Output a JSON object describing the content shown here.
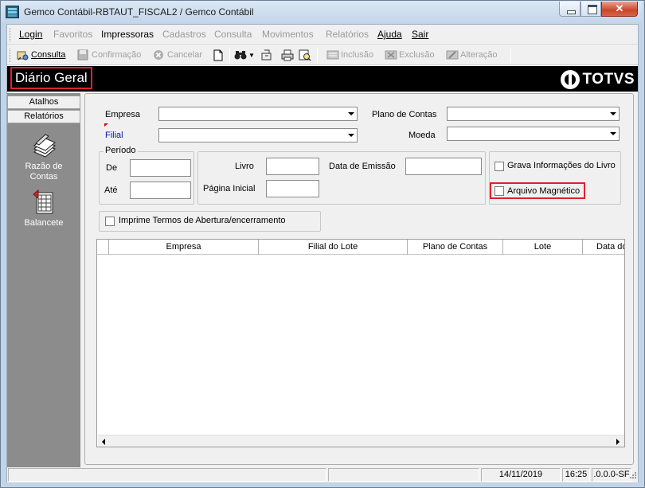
{
  "window": {
    "title": "Gemco Contábil-RBTAUT_FISCAL2 / Gemco Contábil"
  },
  "menu": {
    "items": [
      {
        "label": "Login",
        "enabled": true
      },
      {
        "label": "Favoritos",
        "enabled": false
      },
      {
        "label": "Impressoras",
        "enabled": true
      },
      {
        "label": "Cadastros",
        "enabled": false
      },
      {
        "label": "Consulta",
        "enabled": false
      },
      {
        "label": "Movimentos",
        "enabled": false
      },
      {
        "label": "Relatórios",
        "enabled": false
      },
      {
        "label": "Ajuda",
        "enabled": true
      },
      {
        "label": "Sair",
        "enabled": true
      }
    ]
  },
  "toolbar": {
    "consulta": "Consulta",
    "confirmacao": "Confirmação",
    "cancelar": "Cancelar",
    "inclusao": "Inclusão",
    "exclusao": "Exclusão",
    "alteracao": "Alteração"
  },
  "banner": {
    "title": "Diário Geral",
    "logo_text": "TOTVS"
  },
  "sidebar": {
    "tabs": [
      "Atalhos",
      "Relatórios"
    ],
    "apps": [
      {
        "line1": "Razão de",
        "line2": "Contas",
        "icon": "ledger-icon"
      },
      {
        "line1": "Balancete",
        "line2": "",
        "icon": "balance-sheet-icon"
      }
    ]
  },
  "form": {
    "empresa_label": "Empresa",
    "empresa_value": "",
    "filial_label": "Filial",
    "filial_value": "",
    "plano_label": "Plano de Contas",
    "plano_value": "",
    "moeda_label": "Moeda",
    "moeda_value": "",
    "periodo": {
      "legend": "Período",
      "de_label": "De",
      "de_value": "",
      "ate_label": "Até",
      "ate_value": ""
    },
    "livro_label": "Livro",
    "livro_value": "",
    "pagina_label": "Página Inicial",
    "pagina_value": "",
    "emissao_label": "Data de Emissão",
    "emissao_value": "",
    "grava_label": "Grava Informações do Livro",
    "grava_checked": false,
    "arquivo_label": "Arquivo Magnético",
    "arquivo_checked": false,
    "termos_label": "Imprime Termos de Abertura/encerramento",
    "termos_checked": false
  },
  "grid": {
    "columns": [
      "Empresa",
      "Filial do Lote",
      "Plano de Contas",
      "Lote",
      "Data do"
    ],
    "rows": []
  },
  "status": {
    "date": "14/11/2019",
    "time": "16:25",
    "version": ".0.0.0-SF"
  },
  "colors": {
    "highlight": "#e0212c",
    "banner_bg": "#000000",
    "sidebar_bg": "#8c8c8c",
    "required_label": "#0018a8"
  }
}
